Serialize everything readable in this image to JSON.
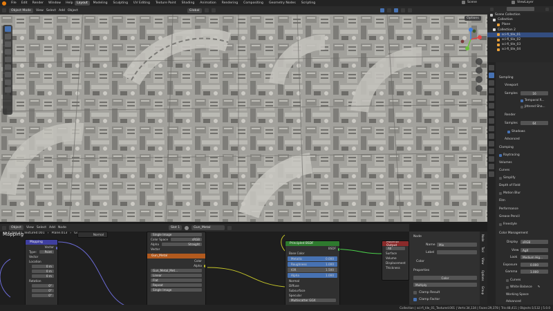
{
  "topbar": {
    "menus": [
      "File",
      "Edit",
      "Render",
      "Window",
      "Help"
    ],
    "workspaces": [
      "Layout",
      "Modeling",
      "Sculpting",
      "UV Editing",
      "Texture Paint",
      "Shading",
      "Animation",
      "Rendering",
      "Compositing",
      "Geometry Nodes",
      "Scripting"
    ],
    "active_workspace": "Layout",
    "scene": "Scene",
    "view_layer": "ViewLayer"
  },
  "viewport": {
    "mode": "Object Mode",
    "menus": [
      "View",
      "Select",
      "Add",
      "Object"
    ],
    "orientation": "Global",
    "options": "Options"
  },
  "node_editor": {
    "object_type": "Object",
    "menus": [
      "View",
      "Select",
      "Add",
      "Node"
    ],
    "slot": "Slot 1",
    "material": "Gun_Metal",
    "breadcrumb": [
      "sci-fi_tile_01_Textured.001",
      "Plane.013",
      "Gun_Metal"
    ],
    "nodes": {
      "mapping": {
        "title": "Mapping",
        "out": "Vector",
        "type_label": "Type:",
        "type_value": "Point",
        "vector": "Vector",
        "location": "Location",
        "x": "0 m",
        "y": "0 m",
        "z": "0 m",
        "rotation": "Rotation",
        "rx": "0°",
        "ry": "0°",
        "rz": "0°"
      },
      "texcoord_out": "Normal",
      "image": {
        "title": "Gun_Metal",
        "single": "Single Image",
        "colorspace_label": "Color Space",
        "colorspace": "sRGB",
        "alpha_label": "Alpha",
        "alpha": "Straight",
        "vector": "Vector",
        "img": "Gun_Metal_Met...",
        "linear": "Linear",
        "flat": "Flat",
        "repeat": "Repeat",
        "color": "Color",
        "alpha_out": "Alpha",
        "footer": "Single Image"
      },
      "bsdf": {
        "title": "Principled BSDF",
        "out": "BSDF",
        "base_color": "Base Color",
        "metallic": "Metallic",
        "metallic_v": "0.000",
        "roughness": "Roughness",
        "roughness_v": "1.000",
        "ior": "IOR",
        "ior_v": "1.500",
        "alpha": "Alpha",
        "alpha_v": "1.000",
        "normal": "Normal",
        "diffuse": "Diffuse",
        "subsurface": "Subsurface",
        "specular": "Specular",
        "multiscatter": "Multiscatter GGX"
      },
      "output": {
        "title": "Material Output",
        "all": "All",
        "surface": "Surface",
        "volume": "Volume",
        "displacement": "Displacement",
        "thickness": "Thickness"
      }
    }
  },
  "node_sidebar": {
    "section_node": "Node",
    "name_label": "Name",
    "name_value": "Mix",
    "label_label": "Label",
    "color": "Color",
    "section_props": "Properties",
    "color_type": "Color",
    "blend": "Multiply",
    "clamp_result": "Clamp Result",
    "clamp_factor": "Clamp Factor",
    "tabs": [
      "Node",
      "Tool",
      "View",
      "Options",
      "Group",
      "Node Wrangler"
    ]
  },
  "outliner": {
    "root": "Scene Collection",
    "items": [
      "Collection",
      "Plane",
      "Collection 2",
      "sci-fi_tile_01",
      "sci-fi_tile_02",
      "sci-fi_tile_03",
      "sci-fi_tile_04"
    ]
  },
  "properties": {
    "sampling": "Sampling",
    "viewport": "Viewport",
    "samples_label": "Samples",
    "viewport_samples": "16",
    "temporal": "Temporal R...",
    "jitter": "Jittered Sha...",
    "render": "Render",
    "render_samples": "64",
    "shadows": "Shadows",
    "advanced": "Advanced",
    "clamping": "Clamping",
    "raytracing": "Raytracing",
    "volumes": "Volumes",
    "curves": "Curves",
    "simplify": "Simplify",
    "dof": "Depth of Field",
    "motion_blur": "Motion Blur",
    "film": "Film",
    "performance": "Performance",
    "grease": "Grease Pencil",
    "freestyle": "Freestyle",
    "color_mgmt": "Color Management",
    "display_label": "Display",
    "display": "sRGB",
    "view_label": "View",
    "view": "AgX",
    "look_label": "Look",
    "look": "Medium Hig...",
    "exposure_label": "Exposure",
    "exposure": "0.000",
    "gamma_label": "Gamma",
    "gamma": "1.000",
    "curves2": "Curves",
    "white_balance": "White Balance",
    "working_space": "Working Space",
    "advanced2": "Advanced"
  },
  "status": "Collection | sci-fi_tile_01_Textured.001 | Verts:34,134 | Faces:29,378 | Tris:48,411 | Objects:1/132 | 5.0.0",
  "colors": {
    "accent": "#4772b3",
    "header": "#2b2b2b",
    "image_node": "#b25a1e",
    "shader_node": "#2e7a2e",
    "output_node": "#8a2a2a",
    "mapping_node": "#3f3fa0"
  }
}
